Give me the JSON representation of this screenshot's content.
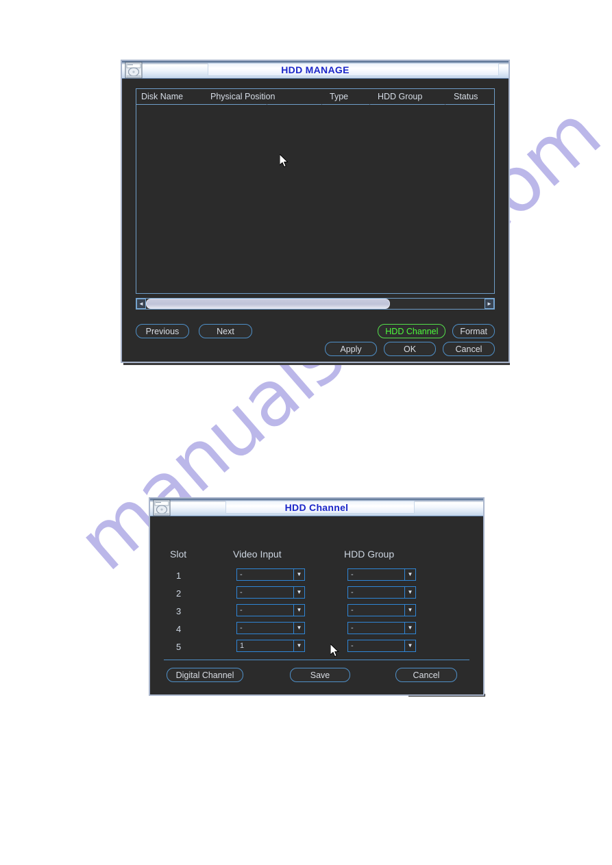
{
  "page": {
    "watermark": "manualshive.com",
    "watermark_color": "#564AC8",
    "background": "#FFFFFF"
  },
  "theme": {
    "dialog_bg": "#2B2B2B",
    "border_blue": "#4F90C8",
    "title_text_color": "#1B26C8",
    "focus_green": "#4DFB3B",
    "label_text": "#D6DDE6"
  },
  "hdd_manage_dialog": {
    "title": "HDD MANAGE",
    "icon": "hdd-icon",
    "table": {
      "columns": [
        "Disk Name",
        "Physical Position",
        "Type",
        "HDD Group",
        "Status"
      ],
      "rows": []
    },
    "scrollbar": {
      "left_arrow": "◄",
      "right_arrow": "►",
      "thumb_percent": 72
    },
    "buttons": {
      "previous": "Previous",
      "next": "Next",
      "hdd_channel": "HDD Channel",
      "format": "Format",
      "apply": "Apply",
      "ok": "OK",
      "cancel": "Cancel"
    },
    "focused_button": "HDD Channel"
  },
  "hdd_channel_dialog": {
    "title": "HDD Channel",
    "icon": "hdd-icon",
    "headers": {
      "slot": "Slot",
      "video_input": "Video Input",
      "hdd_group": "HDD Group"
    },
    "rows": [
      {
        "slot": "1",
        "video_input": "-",
        "hdd_group": "-"
      },
      {
        "slot": "2",
        "video_input": "-",
        "hdd_group": "-"
      },
      {
        "slot": "3",
        "video_input": "-",
        "hdd_group": "-"
      },
      {
        "slot": "4",
        "video_input": "-",
        "hdd_group": "-"
      },
      {
        "slot": "5",
        "video_input": "1",
        "hdd_group": "-"
      }
    ],
    "dropdown_arrow": "▼",
    "buttons": {
      "digital_channel": "Digital Channel",
      "save": "Save",
      "cancel": "Cancel"
    }
  }
}
